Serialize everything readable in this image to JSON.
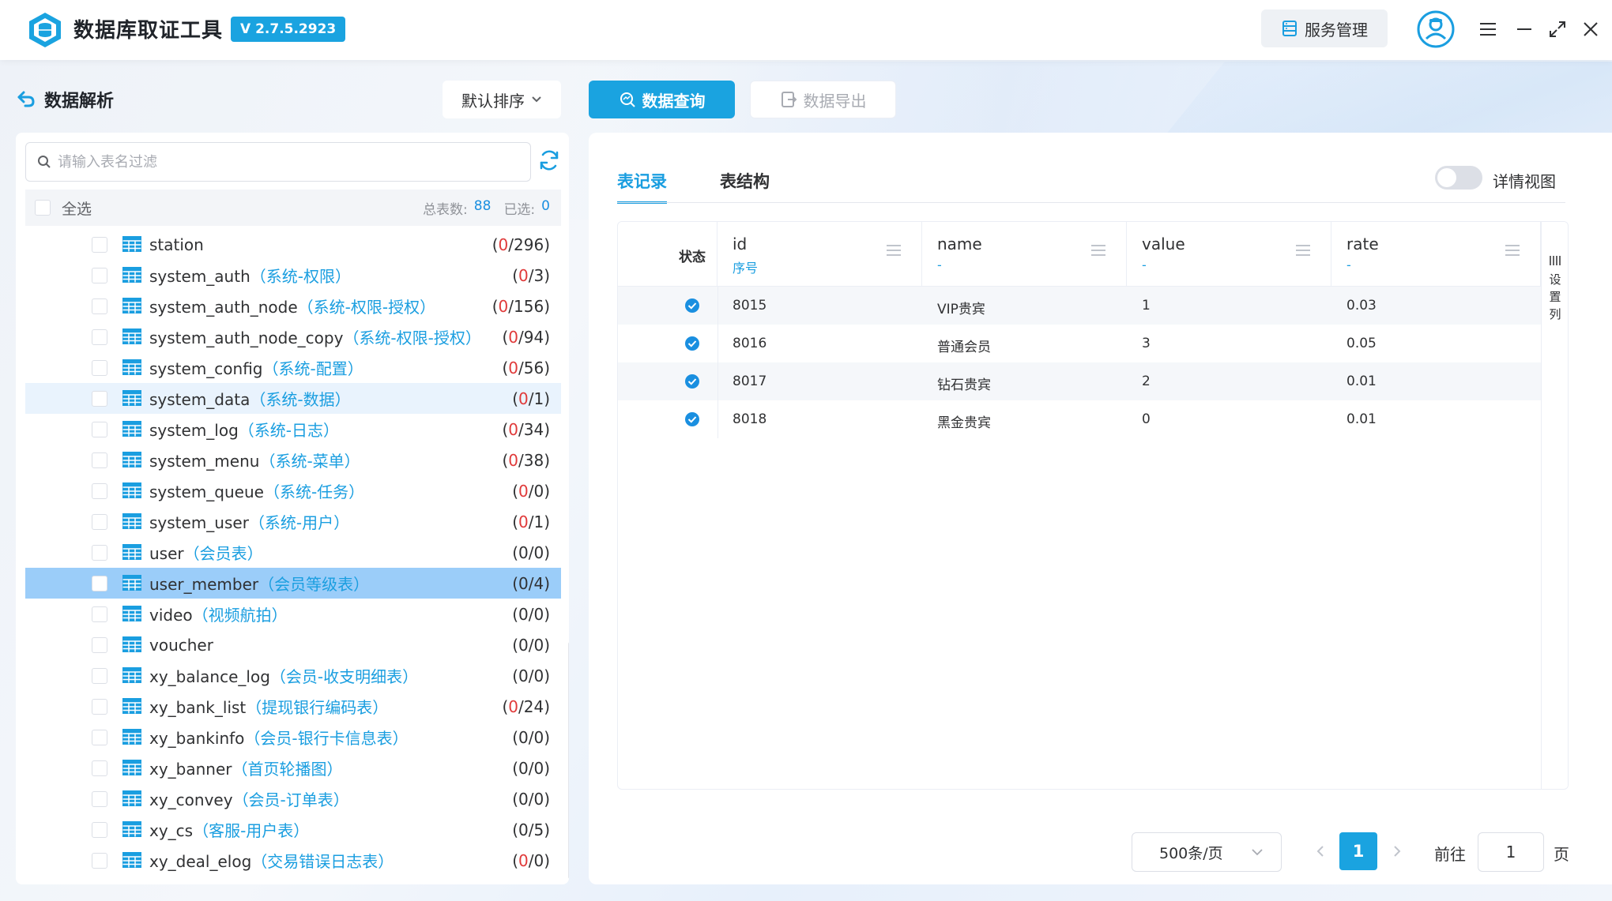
{
  "app": {
    "title": "数据库取证工具",
    "version": "V 2.7.5.2923",
    "service_btn": "服务管理",
    "colors": {
      "accent": "#1aa3e0",
      "count_red": "#e03a3a",
      "table_icon": "#1a9ee0",
      "selected_row": "#9bcdf9"
    }
  },
  "left": {
    "section_title": "数据解析",
    "sort_label": "默认排序",
    "search_placeholder": "请输入表名过滤",
    "select_all_label": "全选",
    "total_label": "总表数:",
    "total_value": "88",
    "selected_label": "已选:",
    "selected_value": "0",
    "tables": [
      {
        "name": "station",
        "cn": "",
        "cnt_left": "(",
        "cnt_red": "0",
        "cnt_right": "/296)"
      },
      {
        "name": "system_auth",
        "cn": "（系统-权限）",
        "cnt_left": "(",
        "cnt_red": "0",
        "cnt_right": "/3)"
      },
      {
        "name": "system_auth_node",
        "cn": "（系统-权限-授权）",
        "cnt_left": "(",
        "cnt_red": "0",
        "cnt_right": "/156)"
      },
      {
        "name": "system_auth_node_copy",
        "cn": "（系统-权限-授权）",
        "cnt_left": "(",
        "cnt_red": "0",
        "cnt_right": "/94)"
      },
      {
        "name": "system_config",
        "cn": "（系统-配置）",
        "cnt_left": "(",
        "cnt_red": "0",
        "cnt_right": "/56)"
      },
      {
        "name": "system_data",
        "cn": "（系统-数据）",
        "cnt_left": "(",
        "cnt_red": "0",
        "cnt_right": "/1)"
      },
      {
        "name": "system_log",
        "cn": "（系统-日志）",
        "cnt_left": "(",
        "cnt_red": "0",
        "cnt_right": "/34)"
      },
      {
        "name": "system_menu",
        "cn": "（系统-菜单）",
        "cnt_left": "(",
        "cnt_red": "0",
        "cnt_right": "/38)"
      },
      {
        "name": "system_queue",
        "cn": "（系统-任务）",
        "cnt_left": "(",
        "cnt_red": "0",
        "cnt_right": "/0)"
      },
      {
        "name": "system_user",
        "cn": "（系统-用户）",
        "cnt_left": "(",
        "cnt_red": "0",
        "cnt_right": "/1)"
      },
      {
        "name": "user",
        "cn": "（会员表）",
        "cnt_left": "(0/0)",
        "cnt_red": "",
        "cnt_right": ""
      },
      {
        "name": "user_member",
        "cn": "（会员等级表）",
        "cnt_left": "(0/4)",
        "cnt_red": "",
        "cnt_right": ""
      },
      {
        "name": "video",
        "cn": "（视频航拍）",
        "cnt_left": "(0/0)",
        "cnt_red": "",
        "cnt_right": ""
      },
      {
        "name": "voucher",
        "cn": "",
        "cnt_left": "(0/0)",
        "cnt_red": "",
        "cnt_right": ""
      },
      {
        "name": "xy_balance_log",
        "cn": "（会员-收支明细表）",
        "cnt_left": "(0/0)",
        "cnt_red": "",
        "cnt_right": ""
      },
      {
        "name": "xy_bank_list",
        "cn": "（提现银行编码表）",
        "cnt_left": "(",
        "cnt_red": "0",
        "cnt_right": "/24)"
      },
      {
        "name": "xy_bankinfo",
        "cn": "（会员-银行卡信息表）",
        "cnt_left": "(0/0)",
        "cnt_red": "",
        "cnt_right": ""
      },
      {
        "name": "xy_banner",
        "cn": "（首页轮播图）",
        "cnt_left": "(0/0)",
        "cnt_red": "",
        "cnt_right": ""
      },
      {
        "name": "xy_convey",
        "cn": "（会员-订单表）",
        "cnt_left": "(0/0)",
        "cnt_red": "",
        "cnt_right": ""
      },
      {
        "name": "xy_cs",
        "cn": "（客服-用户表）",
        "cnt_left": "(0/5)",
        "cnt_red": "",
        "cnt_right": ""
      },
      {
        "name": "xy_deal_elog",
        "cn": "（交易错误日志表）",
        "cnt_left": "(",
        "cnt_red": "0",
        "cnt_right": "/0)"
      }
    ]
  },
  "right": {
    "query_btn": "数据查询",
    "export_btn": "数据导出",
    "tab_records": "表记录",
    "tab_structure": "表结构",
    "detail_view_label": "详情视图",
    "columns": {
      "status": "状态",
      "id": "id",
      "id_sub": "序号",
      "name": "name",
      "name_sub": "-",
      "value": "value",
      "value_sub": "-",
      "rate": "rate",
      "rate_sub": "-"
    },
    "rows": [
      {
        "id": "8015",
        "name": "VIP贵宾",
        "value": "1",
        "rate": "0.03"
      },
      {
        "id": "8016",
        "name": "普通会员",
        "value": "3",
        "rate": "0.05"
      },
      {
        "id": "8017",
        "name": "钻石贵宾",
        "value": "2",
        "rate": "0.01"
      },
      {
        "id": "8018",
        "name": "黑金贵宾",
        "value": "0",
        "rate": "0.01"
      }
    ],
    "settings_col": "设置列",
    "settings_col_chars": [
      "设",
      "置",
      "列"
    ],
    "page_size": "500条/页",
    "current_page": "1",
    "goto_label": "前往",
    "goto_value": "1",
    "page_label": "页"
  }
}
